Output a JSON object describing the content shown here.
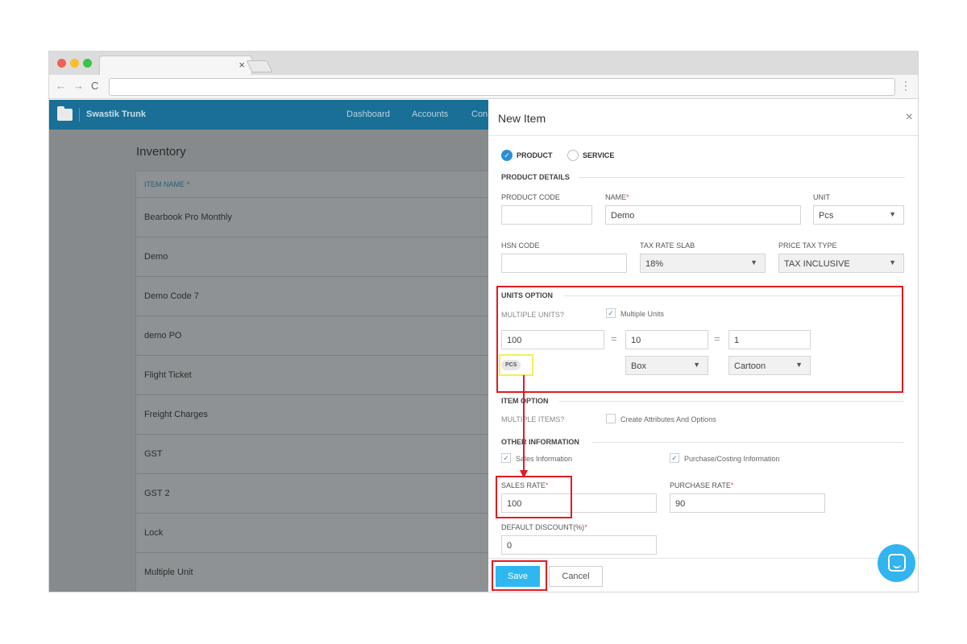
{
  "app": {
    "brand": "Swastik Trunk",
    "nav": [
      "Dashboard",
      "Accounts",
      "Con"
    ]
  },
  "inventory": {
    "title": "Inventory",
    "column_header": "ITEM NAME ^",
    "rows": [
      "Bearbook Pro Monthly",
      "Demo",
      "Demo Code 7",
      "demo PO",
      "Flight Ticket",
      "Freight Charges",
      "GST",
      "GST 2",
      "Lock",
      "Multiple Unit"
    ]
  },
  "modal": {
    "title": "New Item",
    "close": "×",
    "type_product": "PRODUCT",
    "type_service": "SERVICE",
    "product_details": "PRODUCT DETAILS",
    "product_code_label": "PRODUCT CODE",
    "product_code_value": "",
    "name_label": "NAME",
    "name_value": "Demo",
    "unit_label": "UNIT",
    "unit_value": "Pcs",
    "hsn_label": "HSN CODE",
    "hsn_value": "",
    "tax_slab_label": "TAX RATE SLAB",
    "tax_slab_value": "18%",
    "price_tax_label": "PRICE TAX TYPE",
    "price_tax_value": "TAX INCLUSIVE",
    "units_option": "UNITS OPTION",
    "multiple_units_label": "MULTIPLE UNITS?",
    "multiple_units_check": "Multiple Units",
    "unit_qty_1": "100",
    "unit_qty_2": "10",
    "unit_qty_3": "1",
    "unit_chip": "PCS",
    "unit_select_2": "Box",
    "unit_select_3": "Cartoon",
    "item_option": "ITEM OPTION",
    "multiple_items_label": "MULTIPLE ITEMS?",
    "create_attributes": "Create Attributes And Options",
    "other_information": "OTHER INFORMATION",
    "sales_information": "Sales Information",
    "purchase_information": "Purchase/Costing Information",
    "sales_rate_label": "SALES RATE",
    "sales_rate_value": "100",
    "purchase_rate_label": "PURCHASE RATE",
    "purchase_rate_value": "90",
    "default_discount_label": "DEFAULT DISCOUNT(%)",
    "default_discount_value": "0",
    "save": "Save",
    "cancel": "Cancel"
  },
  "colors": {
    "header": "#1a6f96",
    "accent": "#2fb8ef",
    "highlight": "#e11b22"
  }
}
